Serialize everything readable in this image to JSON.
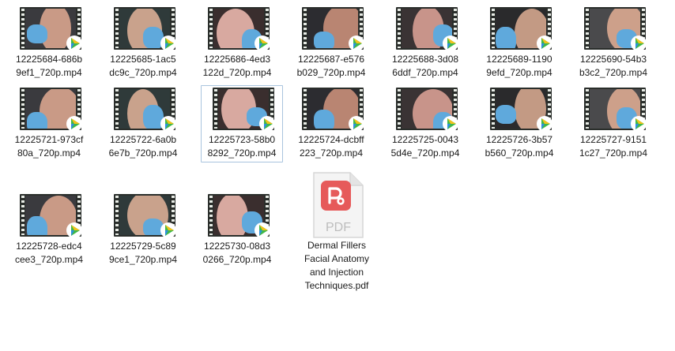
{
  "files": [
    {
      "name": "12225684-686b9ef1_720p.mp4",
      "line1": "12225684-686b",
      "line2": "9ef1_720p.mp4",
      "icon": "video-thumbnail"
    },
    {
      "name": "12225685-1ac5dc9c_720p.mp4",
      "line1": "12225685-1ac5",
      "line2": "dc9c_720p.mp4",
      "icon": "video-thumbnail"
    },
    {
      "name": "12225686-4ed3122d_720p.mp4",
      "line1": "12225686-4ed3",
      "line2": "122d_720p.mp4",
      "icon": "video-thumbnail"
    },
    {
      "name": "12225687-e576b029_720p.mp4",
      "line1": "12225687-e576",
      "line2": "b029_720p.mp4",
      "icon": "video-thumbnail"
    },
    {
      "name": "12225688-3d086ddf_720p.mp4",
      "line1": "12225688-3d08",
      "line2": "6ddf_720p.mp4",
      "icon": "video-thumbnail"
    },
    {
      "name": "12225689-11909efd_720p.mp4",
      "line1": "12225689-1190",
      "line2": "9efd_720p.mp4",
      "icon": "video-thumbnail"
    },
    {
      "name": "12225690-54b3b3c2_720p.mp4",
      "line1": "12225690-54b3",
      "line2": "b3c2_720p.mp4",
      "icon": "video-thumbnail"
    },
    {
      "name": "12225721-973cf80a_720p.mp4",
      "line1": "12225721-973cf",
      "line2": "80a_720p.mp4",
      "icon": "video-thumbnail"
    },
    {
      "name": "12225722-6a0b6e7b_720p.mp4",
      "line1": "12225722-6a0b",
      "line2": "6e7b_720p.mp4",
      "icon": "video-thumbnail"
    },
    {
      "name": "12225723-58b08292_720p.mp4",
      "line1": "12225723-58b0",
      "line2": "8292_720p.mp4",
      "icon": "video-thumbnail",
      "selected": true
    },
    {
      "name": "12225724-dcbff223_720p.mp4",
      "line1": "12225724-dcbff",
      "line2": "223_720p.mp4",
      "icon": "video-thumbnail"
    },
    {
      "name": "12225725-00435d4e_720p.mp4",
      "line1": "12225725-0043",
      "line2": "5d4e_720p.mp4",
      "icon": "video-thumbnail"
    },
    {
      "name": "12225726-3b57b560_720p.mp4",
      "line1": "12225726-3b57",
      "line2": "b560_720p.mp4",
      "icon": "video-thumbnail"
    },
    {
      "name": "12225727-91511c27_720p.mp4",
      "line1": "12225727-9151",
      "line2": "1c27_720p.mp4",
      "icon": "video-thumbnail"
    },
    {
      "name": "12225728-edc4cee3_720p.mp4",
      "line1": "12225728-edc4",
      "line2": "cee3_720p.mp4",
      "icon": "video-thumbnail"
    },
    {
      "name": "12225729-5c899ce1_720p.mp4",
      "line1": "12225729-5c89",
      "line2": "9ce1_720p.mp4",
      "icon": "video-thumbnail"
    },
    {
      "name": "12225730-08d30266_720p.mp4",
      "line1": "12225730-08d3",
      "line2": "0266_720p.mp4",
      "icon": "video-thumbnail"
    }
  ],
  "pdf": {
    "name_lines": [
      "Dermal Fillers",
      "Facial Anatomy",
      "and Injection",
      "Techniques.pdf"
    ],
    "badge": "PDF",
    "icon": "pdf-document-icon"
  },
  "colors": {
    "selection_border": "#a9c4de",
    "glove_blue": "#5fa9dc",
    "pdf_red": "#e65a5a",
    "play_green": "#3fb84a",
    "play_yellow": "#f2c21b",
    "play_blue": "#2d8fe0"
  }
}
